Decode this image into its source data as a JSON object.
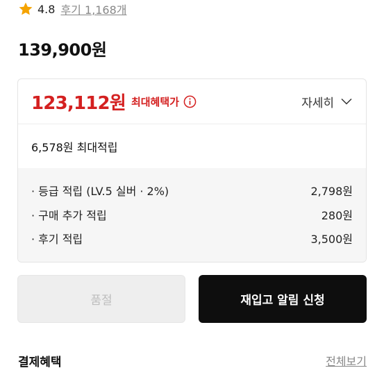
{
  "rating": {
    "score": "4.8",
    "reviews": "후기 1,168개",
    "star_color": "#f5a300"
  },
  "original_price": "139,900원",
  "benefit": {
    "sale_price": "123,112원",
    "max_label": "최대혜택가",
    "detail_label": "자세히",
    "points_summary": "6,578원 최대적립",
    "rows": [
      {
        "label": "· 등급 적립 (LV.5 실버 · 2%)",
        "value": "2,798원"
      },
      {
        "label": "· 구매 추가 적립",
        "value": "280원"
      },
      {
        "label": "· 후기 적립",
        "value": "3,500원"
      }
    ],
    "accent_color": "#d42020"
  },
  "buttons": {
    "soldout": "품절",
    "restock": "재입고 알림 신청"
  },
  "payment": {
    "title": "결제혜택",
    "view_all": "전체보기"
  }
}
